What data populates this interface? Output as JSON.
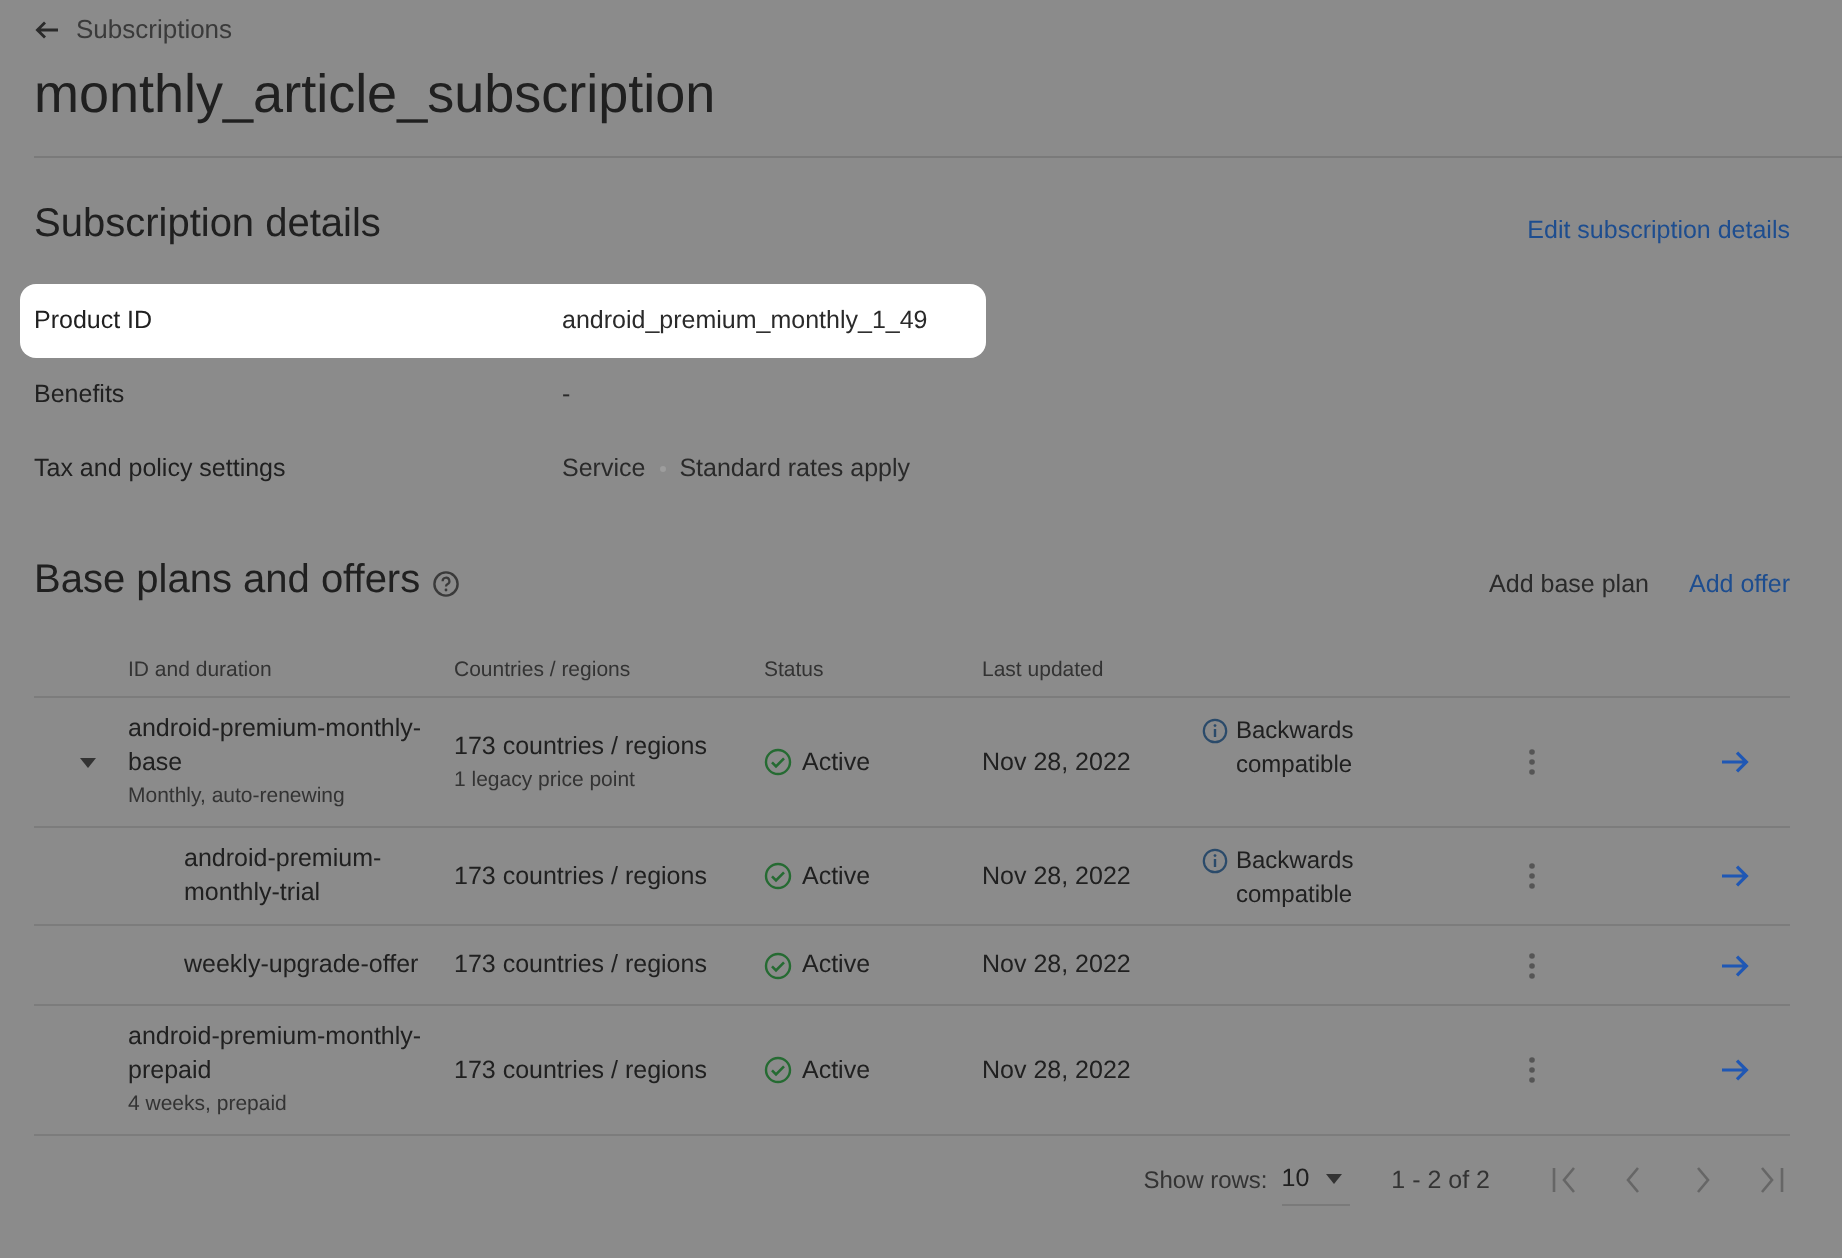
{
  "breadcrumb": {
    "label": "Subscriptions"
  },
  "title": "monthly_article_subscription",
  "details": {
    "heading": "Subscription details",
    "edit_link": "Edit subscription details",
    "fields": [
      {
        "label": "Product ID",
        "value": [
          "android_premium_monthly_1_49"
        ],
        "highlighted": true
      },
      {
        "label": "Benefits",
        "value": [
          "-"
        ],
        "highlighted": false
      },
      {
        "label": "Tax and policy settings",
        "value": [
          "Service",
          "Standard rates apply"
        ],
        "highlighted": false
      }
    ]
  },
  "plans": {
    "heading": "Base plans and offers",
    "actions": [
      {
        "label": "Add base plan",
        "kind": "plain"
      },
      {
        "label": "Add offer",
        "kind": "link"
      }
    ],
    "columns": [
      "ID and duration",
      "Countries / regions",
      "Status",
      "Last updated"
    ],
    "rows": [
      {
        "id": "android-premium-monthly-base",
        "duration": "Monthly, auto-renewing",
        "regions": "173 countries / regions",
        "regions_note": "1 legacy price point",
        "status": "Active",
        "updated": "Nov 28, 2022",
        "note": "Backwards compatible",
        "expanded": true,
        "children": [
          {
            "id": "android-premium-monthly-trial",
            "regions": "173 countries / regions",
            "status": "Active",
            "updated": "Nov 28, 2022",
            "note": "Backwards compatible"
          },
          {
            "id": "weekly-upgrade-offer",
            "regions": "173 countries / regions",
            "status": "Active",
            "updated": "Nov 28, 2022"
          }
        ]
      },
      {
        "id": "android-premium-monthly-prepaid",
        "duration": "4 weeks, prepaid",
        "regions": "173 countries / regions",
        "status": "Active",
        "updated": "Nov 28, 2022",
        "expanded": false
      }
    ]
  },
  "pagination": {
    "rows_label": "Show rows:",
    "rows_value": "10",
    "range": "1 - 2 of 2"
  }
}
